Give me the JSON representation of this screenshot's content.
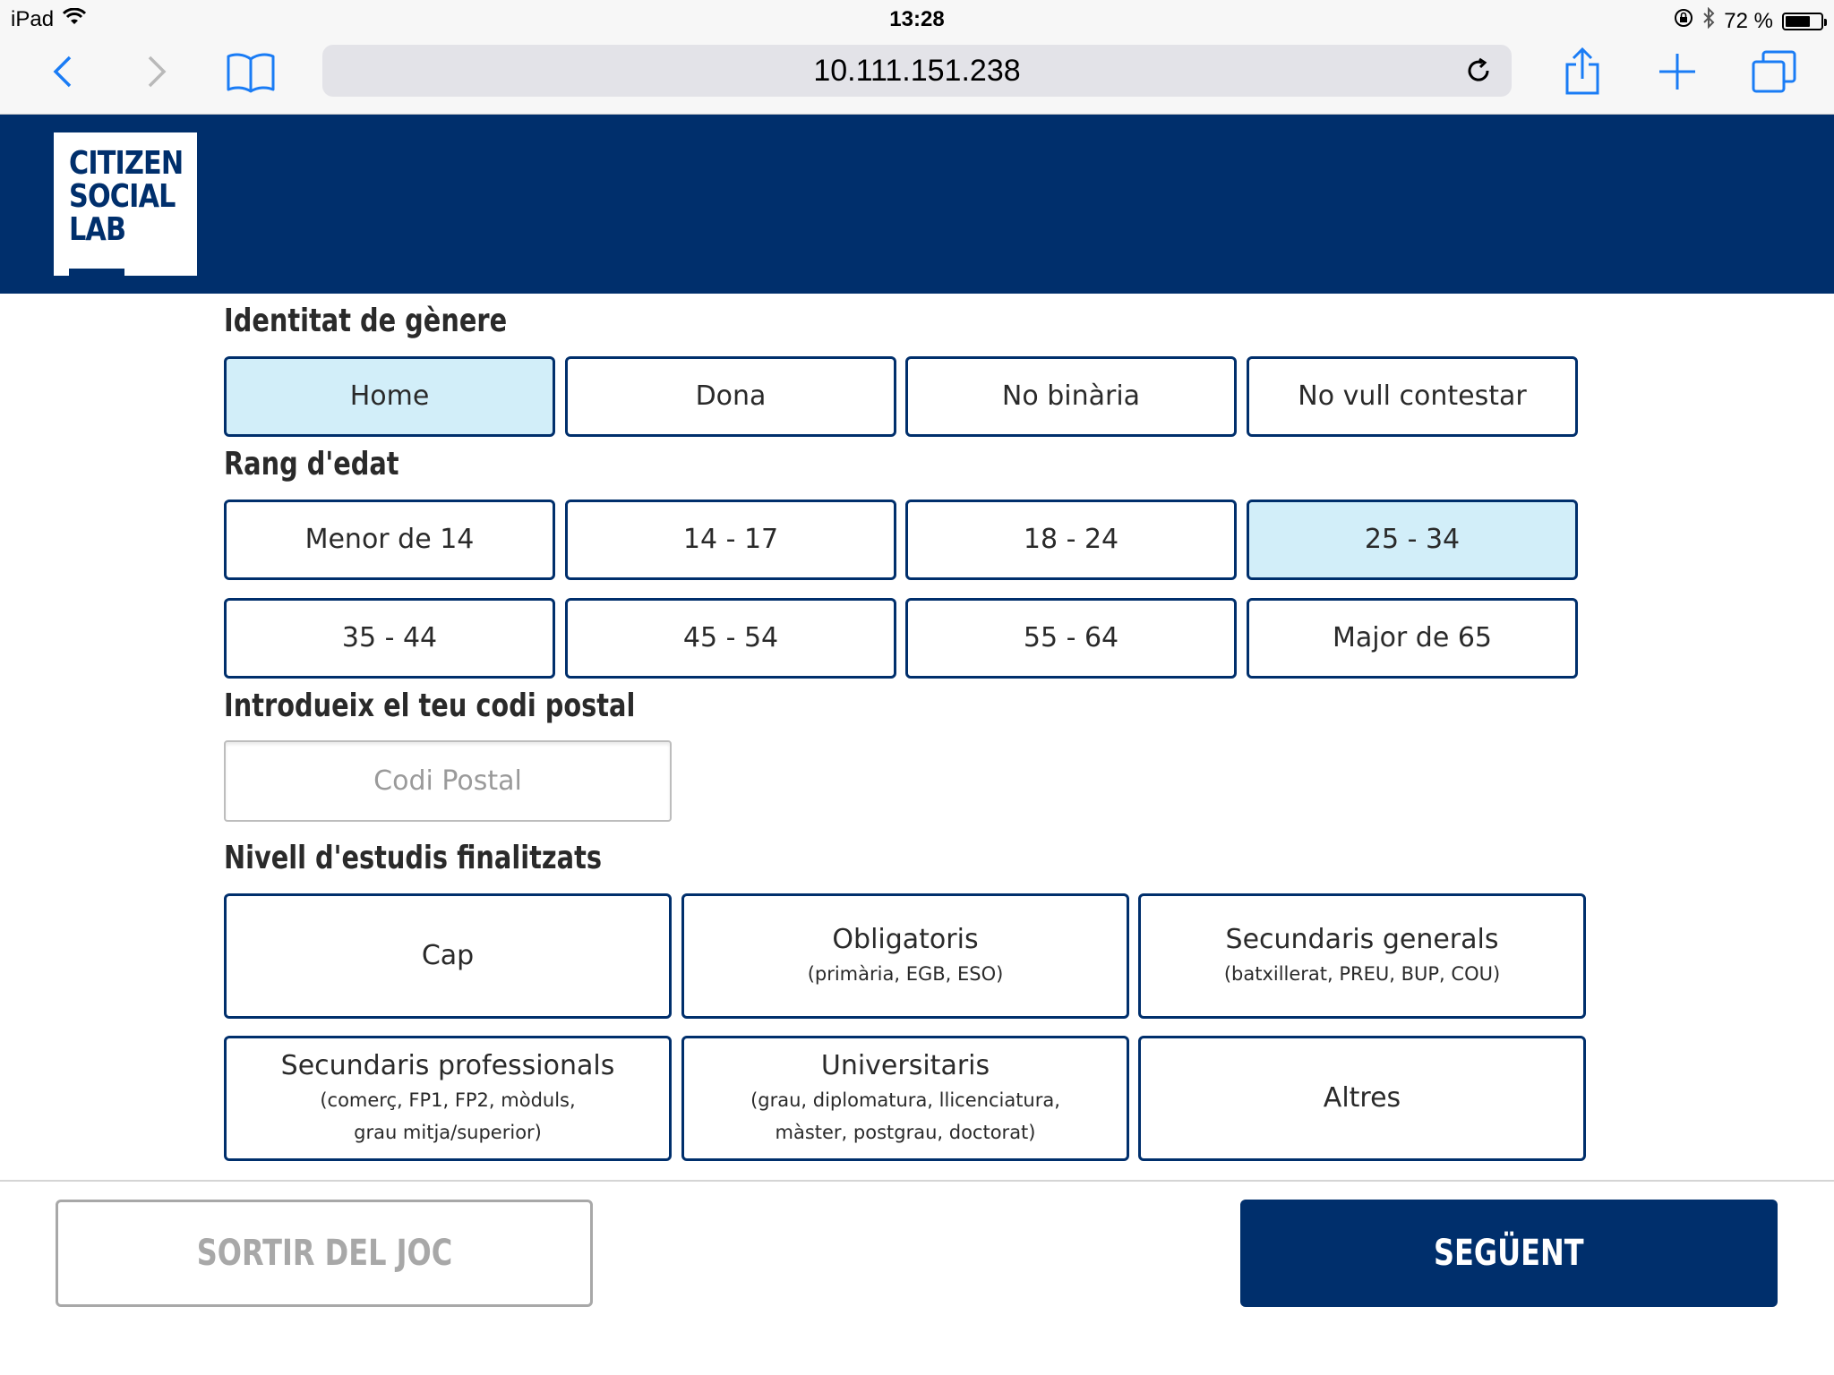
{
  "status_bar": {
    "device": "iPad",
    "time": "13:28",
    "battery": "72 %",
    "battery_level": 0.72,
    "icons": [
      "wifi-icon",
      "orientation-lock-icon",
      "bluetooth-icon",
      "battery-icon"
    ]
  },
  "browser": {
    "url": "10.111.151.238",
    "icons": [
      "back-icon",
      "forward-icon",
      "bookmarks-icon",
      "reload-icon",
      "share-icon",
      "new-tab-icon",
      "tabs-icon"
    ]
  },
  "header": {
    "logo_lines": [
      "CITIZEN",
      "SOCIAL",
      "LAB"
    ]
  },
  "colors": {
    "brand": "#002f6c",
    "selected": "#d2eef9",
    "disabled": "#a8a8a8"
  },
  "gender": {
    "title": "Identitat de gènere",
    "options": [
      "Home",
      "Dona",
      "No binària",
      "No vull contestar"
    ],
    "selected": "Home"
  },
  "age": {
    "title": "Rang d'edat",
    "options": [
      "Menor de 14",
      "14 - 17",
      "18 - 24",
      "25 - 34",
      "35 - 44",
      "45 - 54",
      "55 - 64",
      "Major de 65"
    ],
    "selected": "25 - 34"
  },
  "postal": {
    "title": "Introdueix el teu codi postal",
    "placeholder": "Codi Postal",
    "value": ""
  },
  "education": {
    "title": "Nivell d'estudis finalitzats",
    "options": [
      {
        "label": "Cap",
        "sub1": "",
        "sub2": ""
      },
      {
        "label": "Obligatoris",
        "sub1": "(primària, EGB, ESO)",
        "sub2": ""
      },
      {
        "label": "Secundaris generals",
        "sub1": "(batxillerat, PREU, BUP, COU)",
        "sub2": ""
      },
      {
        "label": "Secundaris professionals",
        "sub1": "(comerç, FP1, FP2, mòduls,",
        "sub2": "grau mitja/superior)"
      },
      {
        "label": "Universitaris",
        "sub1": "(grau, diplomatura, llicenciatura,",
        "sub2": "màster, postgrau, doctorat)"
      },
      {
        "label": "Altres",
        "sub1": "",
        "sub2": ""
      }
    ]
  },
  "footer": {
    "exit_label": "SORTIR DEL JOC",
    "next_label": "SEGÜENT"
  }
}
